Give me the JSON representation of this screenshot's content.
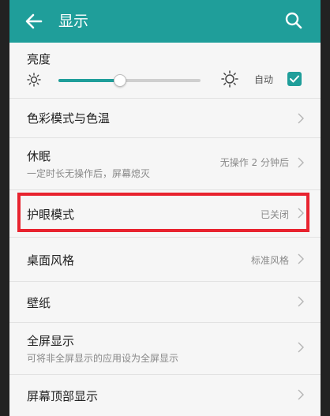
{
  "appbar": {
    "title": "显示"
  },
  "brightness": {
    "label": "亮度",
    "auto_label": "自动",
    "level": 0.43,
    "auto_checked": true
  },
  "rows": [
    {
      "title": "色彩模式与色温",
      "subtitle": "",
      "value": ""
    },
    {
      "title": "休眠",
      "subtitle": "一定时长无操作后，屏幕熄灭",
      "value": "无操作 2 分钟后"
    },
    {
      "title": "护眼模式",
      "subtitle": "",
      "value": "已关闭"
    },
    {
      "title": "桌面风格",
      "subtitle": "",
      "value": "标准风格"
    },
    {
      "title": "壁纸",
      "subtitle": "",
      "value": ""
    },
    {
      "title": "全屏显示",
      "subtitle": "可将非全屏显示的应用设为全屏显示",
      "value": ""
    },
    {
      "title": "屏幕顶部显示",
      "subtitle": "",
      "value": ""
    }
  ],
  "colors": {
    "accent": "#1f9e9a",
    "highlight": "#e8232f"
  }
}
